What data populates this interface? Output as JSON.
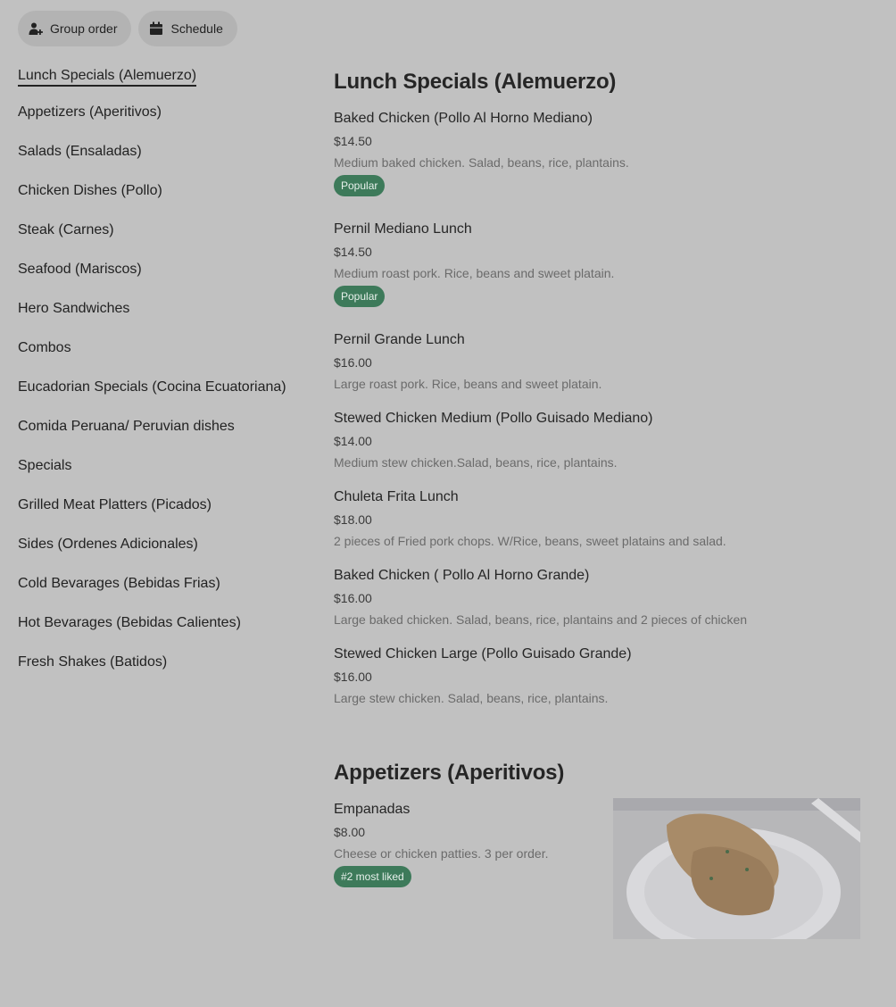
{
  "topbar": {
    "group_order": "Group order",
    "schedule": "Schedule"
  },
  "sidebar": {
    "items": [
      {
        "label": "Lunch Specials (Alemuerzo)",
        "active": true
      },
      {
        "label": "Appetizers (Aperitivos)"
      },
      {
        "label": "Salads (Ensaladas)"
      },
      {
        "label": "Chicken Dishes (Pollo)"
      },
      {
        "label": "Steak (Carnes)"
      },
      {
        "label": "Seafood (Mariscos)"
      },
      {
        "label": "Hero Sandwiches"
      },
      {
        "label": "Combos"
      },
      {
        "label": "Eucadorian Specials (Cocina Ecuatoriana)"
      },
      {
        "label": "Comida Peruana/ Peruvian dishes"
      },
      {
        "label": "Specials"
      },
      {
        "label": "Grilled Meat Platters (Picados)"
      },
      {
        "label": "Sides (Ordenes Adicionales)"
      },
      {
        "label": "Cold Bevarages (Bebidas Frias)"
      },
      {
        "label": "Hot Bevarages (Bebidas Calientes)"
      },
      {
        "label": "Fresh Shakes (Batidos)"
      }
    ]
  },
  "sections": [
    {
      "title": "Lunch Specials (Alemuerzo)",
      "items": [
        {
          "name": "Baked Chicken (Pollo Al Horno Mediano)",
          "price": "$14.50",
          "desc": "Medium baked chicken. Salad, beans, rice, plantains.",
          "badge": "Popular"
        },
        {
          "name": "Pernil Mediano Lunch",
          "price": "$14.50",
          "desc": "Medium roast pork. Rice, beans and sweet platain.",
          "badge": "Popular"
        },
        {
          "name": "Pernil Grande Lunch",
          "price": "$16.00",
          "desc": "Large roast pork. Rice, beans and sweet platain."
        },
        {
          "name": "Stewed Chicken Medium (Pollo Guisado Mediano)",
          "price": "$14.00",
          "desc": "Medium stew chicken.Salad, beans, rice, plantains."
        },
        {
          "name": "Chuleta Frita Lunch",
          "price": "$18.00",
          "desc": "2 pieces of Fried pork chops. W/Rice, beans, sweet platains and salad."
        },
        {
          "name": "Baked Chicken ( Pollo Al Horno Grande)",
          "price": "$16.00",
          "desc": "Large baked chicken. Salad, beans, rice, plantains and 2 pieces of chicken"
        },
        {
          "name": "Stewed Chicken Large (Pollo Guisado Grande)",
          "price": "$16.00",
          "desc": "Large stew chicken. Salad, beans, rice, plantains."
        }
      ]
    },
    {
      "title": "Appetizers (Aperitivos)",
      "items": [
        {
          "name": "Empanadas",
          "price": "$8.00",
          "desc": "Cheese or chicken patties. 3 per order.",
          "badge": "#2 most liked",
          "photo": "empanadas-photo"
        }
      ]
    }
  ],
  "colors": {
    "background": "#c1c1c1",
    "badge": "#3d7a5a",
    "pill": "#b3b3b3"
  }
}
